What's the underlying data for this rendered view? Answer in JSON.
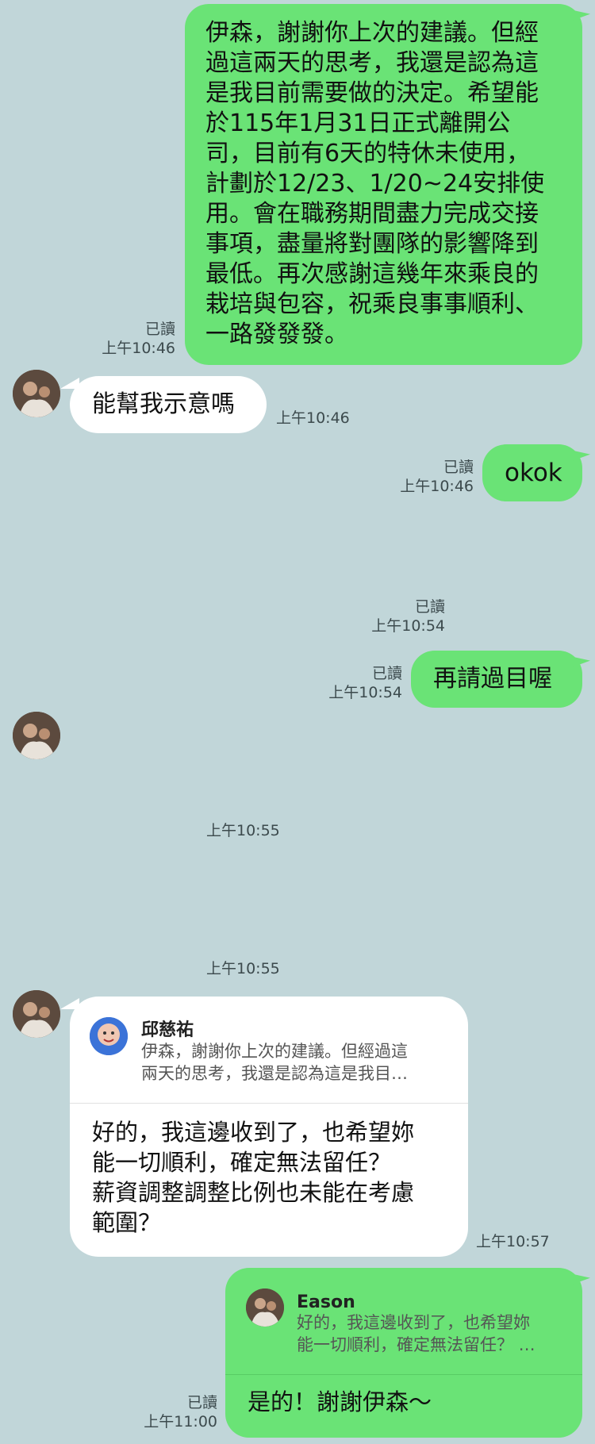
{
  "messages": {
    "m1": {
      "text": "伊森，謝謝你上次的建議。但經\n過這兩天的思考，我還是認為這\n是我目前需要做的決定。希望能\n於115年1月31日正式離開公\n司，目前有6天的特休未使用，\n計劃於12/23、1/20~24安排使\n用。會在職務期間盡力完成交接\n事項，盡量將對團隊的影響降到\n最低。再次感謝這幾年來乘良的\n栽培與包容，祝乘良事事順利、\n一路發發發。",
      "read": "已讀",
      "time": "上午10:46"
    },
    "m2": {
      "text": "能幫我示意嗎",
      "time": "上午10:46"
    },
    "m3": {
      "text": "okok",
      "read": "已讀",
      "time": "上午10:46"
    },
    "m4": {
      "read": "已讀",
      "time": "上午10:54"
    },
    "m5": {
      "text": "再請過目喔",
      "read": "已讀",
      "time": "上午10:54"
    },
    "m6": {
      "time": "上午10:55"
    },
    "m7": {
      "time": "上午10:55"
    },
    "m8": {
      "quote_name": "邱慈祐",
      "quote_text": "伊森，謝謝你上次的建議。但經過這\n兩天的思考，我還是認為這是我目…",
      "text": "好的，我這邊收到了，也希望妳\n能一切順利，確定無法留任？\n薪資調整調整比例也未能在考慮\n範圍？",
      "time": "上午10:57"
    },
    "m9": {
      "quote_name": "Eason",
      "quote_text": "好的，我這邊收到了，也希望妳\n能一切順利，確定無法留任？ …",
      "text": "是的！謝謝伊森～",
      "read": "已讀",
      "time": "上午11:00"
    }
  },
  "colors": {
    "background": "#c1d6d9",
    "outgoing_bubble": "#6ae376",
    "incoming_bubble": "#ffffff"
  },
  "icons": {
    "contact_avatar": "contact-avatar-icon",
    "quote_avatar_1": "quote-avatar-icon",
    "quote_avatar_2": "quote-avatar-icon"
  }
}
